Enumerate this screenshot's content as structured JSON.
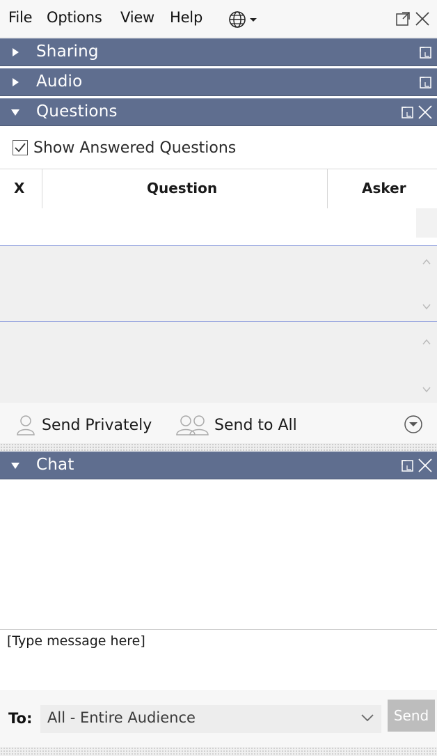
{
  "menubar": {
    "items": [
      "File",
      "Options",
      "View",
      "Help"
    ],
    "globe_icon": "globe-icon",
    "window_controls": [
      "popout-icon",
      "close-icon"
    ]
  },
  "panels": {
    "sharing": {
      "label": "Sharing",
      "expanded": false
    },
    "audio": {
      "label": "Audio",
      "expanded": false
    },
    "questions": {
      "label": "Questions",
      "expanded": true
    },
    "chat": {
      "label": "Chat",
      "expanded": true
    }
  },
  "questions": {
    "show_answered_label": "Show Answered Questions",
    "show_answered_checked": true,
    "columns": [
      "X",
      "Question",
      "Asker"
    ],
    "rows": []
  },
  "actions": {
    "send_privately": "Send Privately",
    "send_to_all": "Send to All"
  },
  "chat": {
    "input_placeholder": "[Type message here]",
    "to_label": "To:",
    "to_value": "All - Entire Audience",
    "send_label": "Send"
  },
  "colors": {
    "panel_header": "#5f6e8f",
    "panel_text": "#ffffff",
    "divider_blue": "#9aa8e0",
    "send_disabled": "#bdbdbd"
  }
}
